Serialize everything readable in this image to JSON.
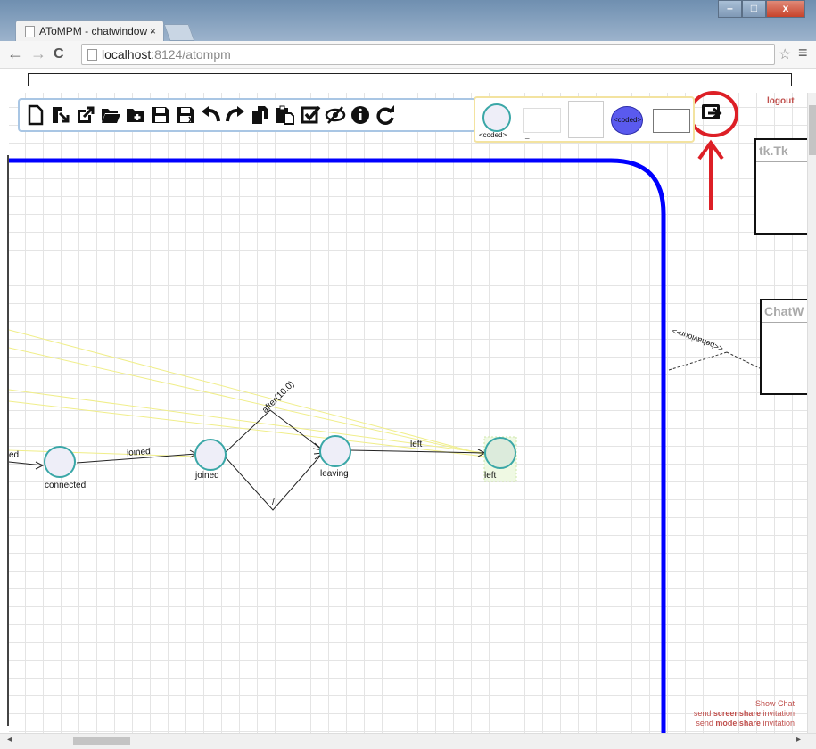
{
  "browser": {
    "tab_title": "AToMPM - chatwindow -",
    "tab_close": "×",
    "url_host": "localhost",
    "url_rest": ":8124/atompm",
    "back": "←",
    "forward": "→",
    "reload": "C",
    "star": "☆",
    "menu": "≡",
    "minimize": "–",
    "maximize": "□",
    "close": "x"
  },
  "toolbar": {
    "icons": [
      "new-file-icon",
      "import-icon",
      "export-icon",
      "open-folder-icon",
      "new-folder-icon",
      "save-icon",
      "save-as-icon",
      "undo-icon",
      "redo-icon",
      "copy-icon",
      "paste-icon",
      "validate-icon",
      "hide-icon",
      "info-icon",
      "refresh-icon"
    ]
  },
  "palette": {
    "circle_label": "<coded>",
    "dash": "_",
    "blue_label": "<coded>"
  },
  "user": {
    "logout": "logout"
  },
  "diagram": {
    "states": [
      {
        "name": "connected"
      },
      {
        "name": "joined"
      },
      {
        "name": "leaving"
      },
      {
        "name": "left"
      }
    ],
    "partial_state": "ed",
    "transitions": {
      "joined": "joined",
      "after": "after(10.0)",
      "left": "left",
      "slash": "/"
    },
    "association": "<<behaviour>>"
  },
  "panels": {
    "p1_title": "tk.Tk",
    "p2_title": "ChatW"
  },
  "links": {
    "show_chat": "Show Chat",
    "send": "send",
    "screenshare": "screenshare",
    "modelshare": "modelshare",
    "invitation": "invitation"
  },
  "colors": {
    "accent_blue": "#0000ff",
    "annotation_red": "#dd1f26",
    "link_red": "#c0504d",
    "state_fill": "#eeeef8",
    "state_border": "#3aa7a7"
  }
}
